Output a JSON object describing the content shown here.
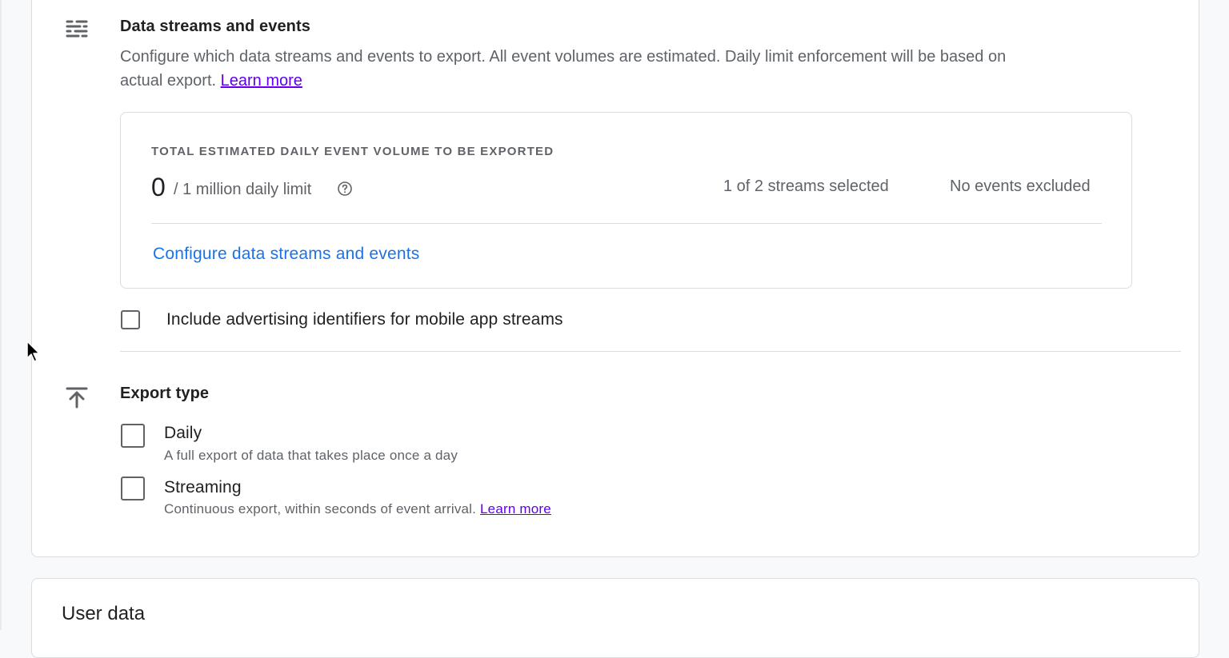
{
  "data_streams_section": {
    "icon": "tune-icon",
    "title": "Data streams and events",
    "description": "Configure which data streams and events to export. All event volumes are estimated. Daily limit enforcement will be based on actual export.",
    "learn_more": "Learn more"
  },
  "volume_box": {
    "label": "TOTAL ESTIMATED DAILY EVENT VOLUME TO BE EXPORTED",
    "value": "0",
    "limit": "/ 1 million daily limit",
    "help_icon": "help-circle-icon",
    "streams_selected": "1 of 2 streams selected",
    "events_excluded": "No events excluded",
    "configure_link": "Configure data streams and events"
  },
  "advertising_identifiers": {
    "label": "Include advertising identifiers for mobile app streams",
    "checked": false
  },
  "export_type_section": {
    "icon": "upload-icon",
    "title": "Export type",
    "options": [
      {
        "label": "Daily",
        "description": "A full export of data that takes place once a day",
        "checked": false
      },
      {
        "label": "Streaming",
        "description": "Continuous export, within seconds of event arrival.",
        "learn_more": "Learn more",
        "checked": false
      }
    ]
  },
  "user_data_section": {
    "title": "User data"
  },
  "colors": {
    "link_blue": "#1a73e8",
    "link_purple": "#6200ee",
    "text_primary": "#202124",
    "text_secondary": "#5f6368",
    "border": "#dadce0"
  }
}
